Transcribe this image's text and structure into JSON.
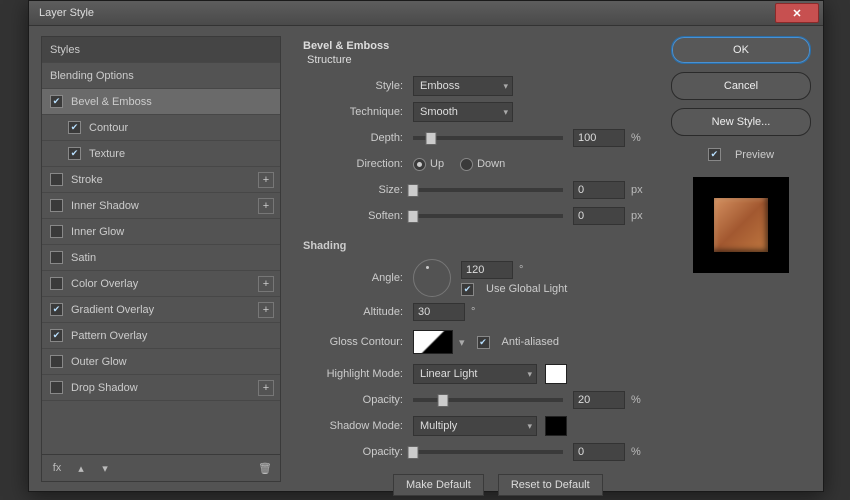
{
  "title": "Layer Style",
  "sidebar": {
    "header": "Styles",
    "blending": "Blending Options",
    "items": [
      {
        "label": "Bevel & Emboss",
        "checked": true,
        "active": true,
        "plus": false
      },
      {
        "label": "Contour",
        "checked": true,
        "sub": true,
        "plus": false
      },
      {
        "label": "Texture",
        "checked": true,
        "sub": true,
        "plus": false
      },
      {
        "label": "Stroke",
        "checked": false,
        "plus": true
      },
      {
        "label": "Inner Shadow",
        "checked": false,
        "plus": true
      },
      {
        "label": "Inner Glow",
        "checked": false,
        "plus": false
      },
      {
        "label": "Satin",
        "checked": false,
        "plus": false
      },
      {
        "label": "Color Overlay",
        "checked": false,
        "plus": true
      },
      {
        "label": "Gradient Overlay",
        "checked": true,
        "plus": true
      },
      {
        "label": "Pattern Overlay",
        "checked": true,
        "plus": false
      },
      {
        "label": "Outer Glow",
        "checked": false,
        "plus": false
      },
      {
        "label": "Drop Shadow",
        "checked": false,
        "plus": true
      }
    ],
    "fx_label": "fx"
  },
  "panel": {
    "title": "Bevel & Emboss",
    "structure": "Structure",
    "style_label": "Style:",
    "style_value": "Emboss",
    "technique_label": "Technique:",
    "technique_value": "Smooth",
    "depth_label": "Depth:",
    "depth_value": "100",
    "depth_unit": "%",
    "direction_label": "Direction:",
    "up_label": "Up",
    "down_label": "Down",
    "size_label": "Size:",
    "size_value": "0",
    "size_unit": "px",
    "soften_label": "Soften:",
    "soften_value": "0",
    "soften_unit": "px",
    "shading": "Shading",
    "angle_label": "Angle:",
    "angle_value": "120",
    "use_global": "Use Global Light",
    "altitude_label": "Altitude:",
    "altitude_value": "30",
    "gloss_label": "Gloss Contour:",
    "aa_label": "Anti-aliased",
    "highlight_label": "Highlight Mode:",
    "highlight_value": "Linear Light",
    "opacity_label": "Opacity:",
    "highlight_opacity": "20",
    "shadow_label": "Shadow Mode:",
    "shadow_value": "Multiply",
    "shadow_opacity": "0",
    "percent": "%",
    "degree": "°",
    "make_default": "Make Default",
    "reset_default": "Reset to Default"
  },
  "right": {
    "ok": "OK",
    "cancel": "Cancel",
    "new_style": "New Style...",
    "preview": "Preview"
  }
}
